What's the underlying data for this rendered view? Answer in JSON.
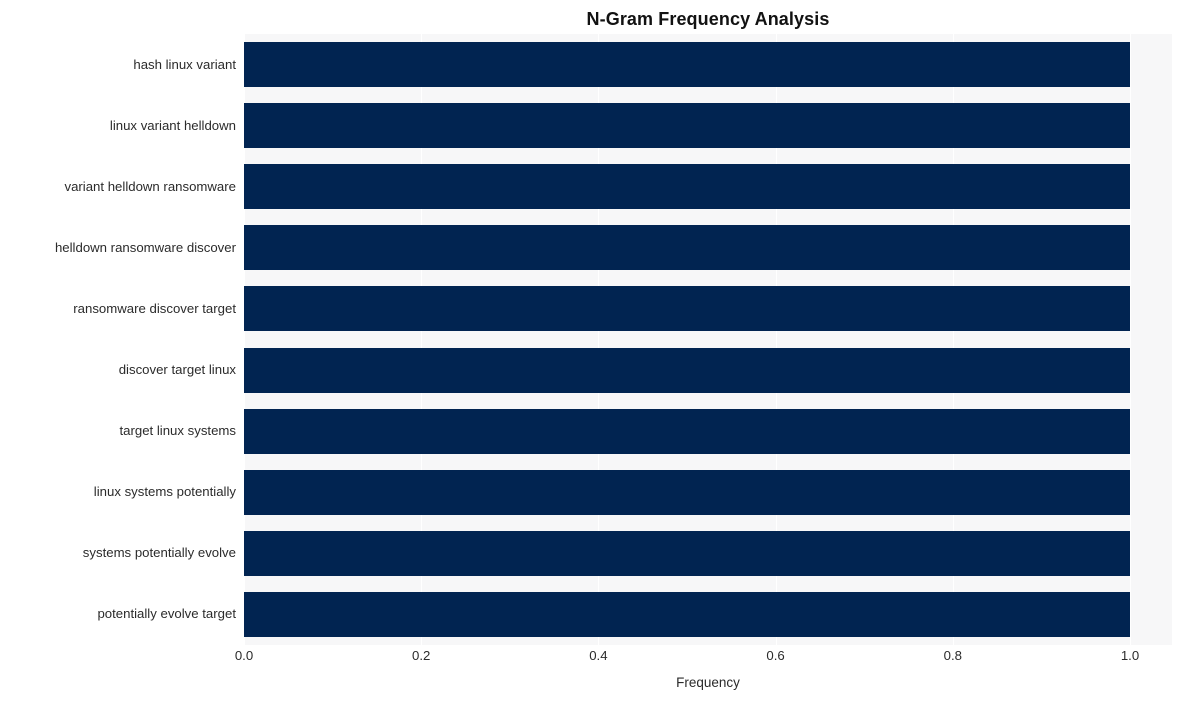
{
  "chart_data": {
    "type": "bar",
    "orientation": "horizontal",
    "title": "N-Gram Frequency Analysis",
    "xlabel": "Frequency",
    "ylabel": "",
    "xlim": [
      0.0,
      1.0
    ],
    "xticks": [
      "0.0",
      "0.2",
      "0.4",
      "0.6",
      "0.8",
      "1.0"
    ],
    "xtick_values": [
      0.0,
      0.2,
      0.4,
      0.6,
      0.8,
      1.0
    ],
    "grid": "vertical",
    "legend": "none",
    "bar_color": "#012451",
    "plot_background": "#f7f7f8",
    "gridline_color": "#ffffff",
    "categories": [
      "hash linux variant",
      "linux variant helldown",
      "variant helldown ransomware",
      "helldown ransomware discover",
      "ransomware discover target",
      "discover target linux",
      "target linux systems",
      "linux systems potentially",
      "systems potentially evolve",
      "potentially evolve target"
    ],
    "values": [
      1.0,
      1.0,
      1.0,
      1.0,
      1.0,
      1.0,
      1.0,
      1.0,
      1.0,
      1.0
    ]
  }
}
